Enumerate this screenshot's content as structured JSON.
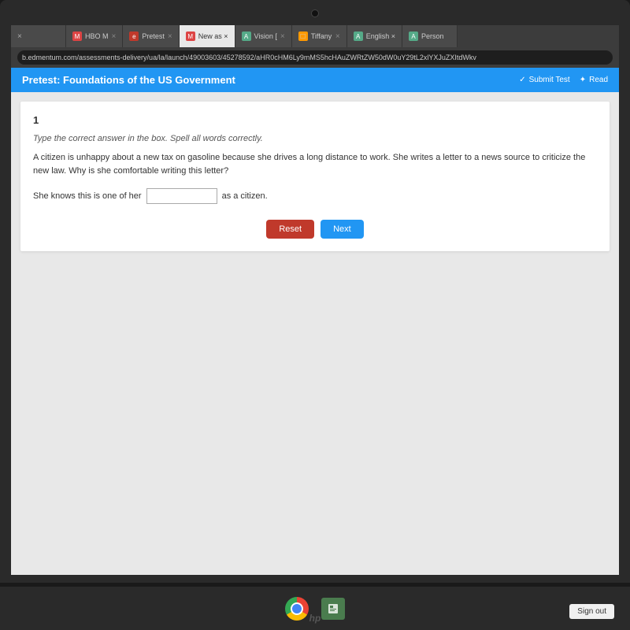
{
  "browser": {
    "address": "b.edmentum.com/assessments-delivery/ua/la/launch/49003603/45278592/aHR0cHM6Ly9mMS5hcHAuZWRtZW50dW0uY29tL2xlYXJuZXItdWkv",
    "tabs": [
      {
        "id": "tab1",
        "icon_color": "#aaa",
        "icon_symbol": "×",
        "label": "×",
        "active": false,
        "show_close": true
      },
      {
        "id": "tab2",
        "icon_color": "#d44",
        "icon_symbol": "M",
        "label": "HBO M×",
        "active": false,
        "show_close": true
      },
      {
        "id": "tab3",
        "icon_color": "#e66",
        "icon_symbol": "e",
        "label": "Pretest ×",
        "active": false,
        "show_close": true
      },
      {
        "id": "tab4",
        "icon_color": "#d44",
        "icon_symbol": "M",
        "label": "New as ×",
        "active": true,
        "show_close": true
      },
      {
        "id": "tab5",
        "icon_color": "#5a8",
        "icon_symbol": "A",
        "label": "Vision [ ×",
        "active": false,
        "show_close": true
      },
      {
        "id": "tab6",
        "icon_color": "#f90",
        "icon_symbol": "□",
        "label": "Tiffany ×",
        "active": false,
        "show_close": true
      },
      {
        "id": "tab7",
        "icon_color": "#5a8",
        "icon_symbol": "A",
        "label": "English ×",
        "active": false,
        "show_close": true
      },
      {
        "id": "tab8",
        "icon_color": "#5a8",
        "icon_symbol": "A",
        "label": "Person",
        "active": false,
        "show_close": false
      }
    ]
  },
  "assessment": {
    "title": "Pretest: Foundations of the US Government",
    "submit_label": "Submit Test",
    "read_label": "Read"
  },
  "question": {
    "number": "1",
    "instruction": "Type the correct answer in the box. Spell all words correctly.",
    "text": "A citizen is unhappy about a new tax on gasoline because she drives a long distance to work. She writes a letter to a news source to criticize the new law. Why is she comfortable writing this letter?",
    "answer_prefix": "She knows this is one of her",
    "answer_placeholder": "",
    "answer_suffix": "as a citizen.",
    "reset_label": "Reset",
    "next_label": "Next"
  },
  "taskbar": {
    "sign_out": "Sign out"
  },
  "laptop": {
    "brand": "hp"
  }
}
